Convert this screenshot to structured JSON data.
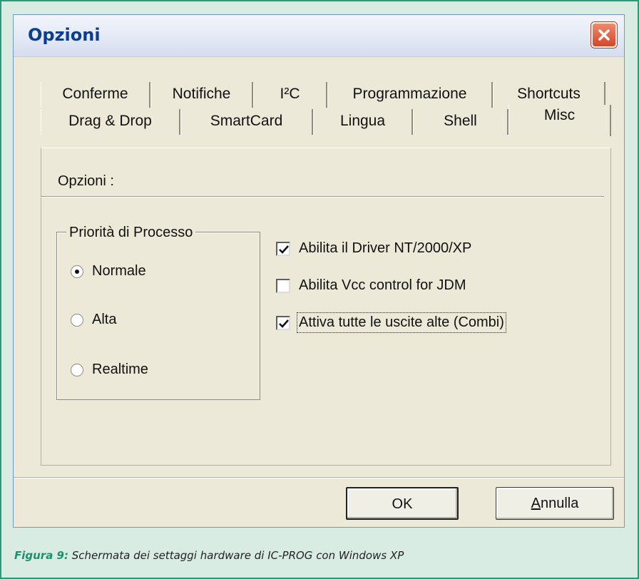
{
  "window": {
    "title": "Opzioni"
  },
  "tabs_row1": [
    "Conferme",
    "Notifiche",
    "I²C",
    "Programmazione",
    "Shortcuts"
  ],
  "tabs_row2": [
    "Drag & Drop",
    "SmartCard",
    "Lingua",
    "Shell",
    "Misc"
  ],
  "active_tab": "Misc",
  "panel": {
    "section_label": "Opzioni :",
    "priority_group": {
      "label": "Priorità di Processo",
      "options": [
        "Normale",
        "Alta",
        "Realtime"
      ],
      "selected": "Normale"
    },
    "checkboxes": [
      {
        "label": "Abilita il Driver NT/2000/XP",
        "checked": true
      },
      {
        "label": "Abilita Vcc control for JDM",
        "checked": false
      },
      {
        "label": "Attiva tutte le uscite alte (Combi)",
        "checked": true
      }
    ]
  },
  "buttons": {
    "ok": "OK",
    "cancel_first": "A",
    "cancel_rest": "nnulla"
  },
  "caption": {
    "prefix": "Figura 9:",
    "text": "Schermata dei settaggi hardware di IC-PROG con Windows XP"
  },
  "colors": {
    "frame": "#2a9a78",
    "caption_prefix": "#1f8f6c",
    "title": "#0b3d91",
    "close": "#d4462a"
  }
}
